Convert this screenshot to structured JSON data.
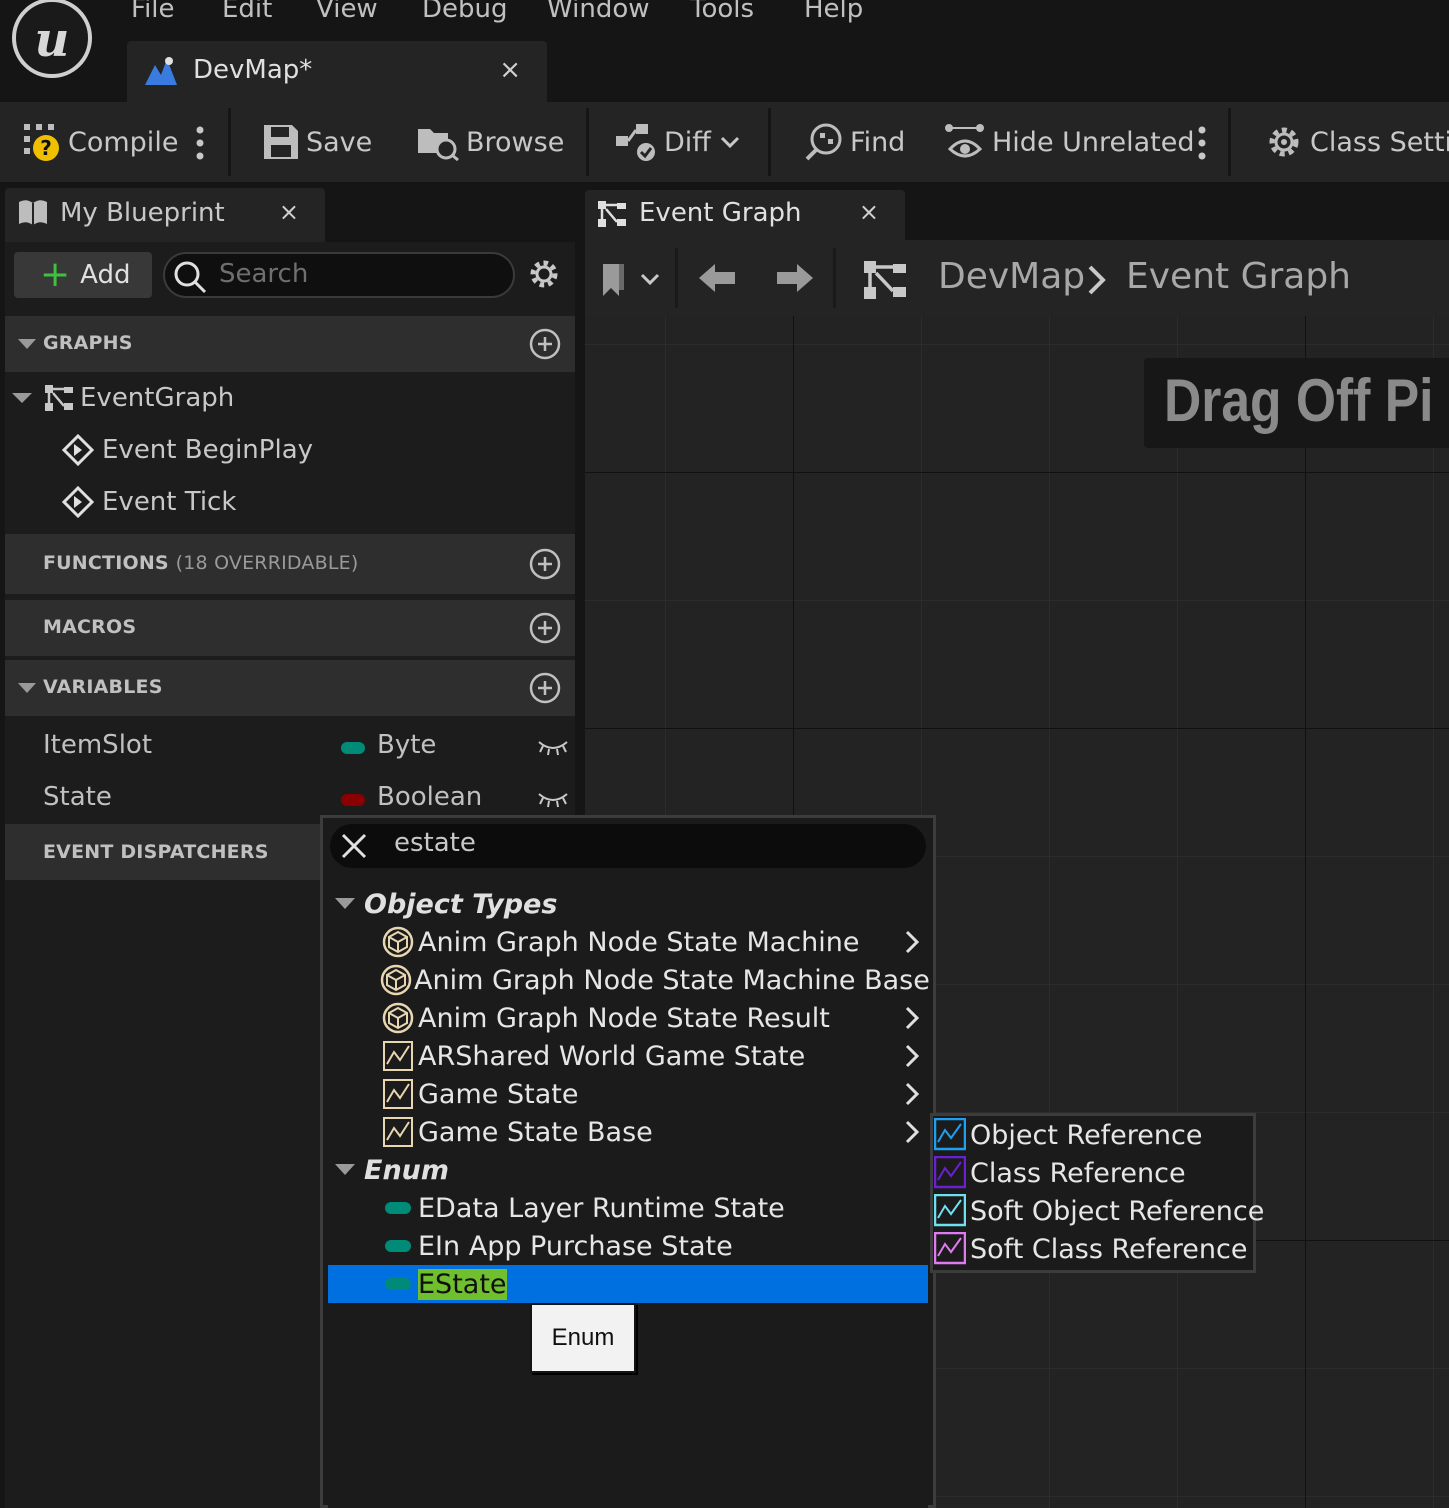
{
  "menu": [
    "File",
    "Edit",
    "View",
    "Debug",
    "Window",
    "Tools",
    "Help"
  ],
  "document_tab": {
    "title": "DevMap*",
    "close": "×"
  },
  "toolbar": {
    "compile": "Compile",
    "save": "Save",
    "browse": "Browse",
    "diff": "Diff",
    "find": "Find",
    "hide_unrelated": "Hide Unrelated",
    "class_settings": "Class Settin"
  },
  "my_blueprint": {
    "tab_title": "My Blueprint",
    "close": "×",
    "add_label": "Add",
    "search_placeholder": "Search",
    "sections": {
      "graphs": "GRAPHS",
      "functions": "FUNCTIONS",
      "functions_sub": "(18 OVERRIDABLE)",
      "macros": "MACROS",
      "variables": "VARIABLES",
      "event_dispatchers": "EVENT DISPATCHERS"
    },
    "graphs": {
      "event_graph": "EventGraph",
      "events": [
        "Event BeginPlay",
        "Event Tick"
      ]
    },
    "variables": [
      {
        "name": "ItemSlot",
        "type": "Byte",
        "color": "#008a78"
      },
      {
        "name": "State",
        "type": "Boolean",
        "color": "#8a0000"
      }
    ]
  },
  "graph_editor": {
    "tab_title": "Event Graph",
    "close": "×",
    "breadcrumb": [
      "DevMap",
      "Event Graph"
    ],
    "overlay_text": "Drag Off Pi"
  },
  "type_picker": {
    "search_value": "estate",
    "categories": {
      "object_types": {
        "label": "Object Types",
        "items": [
          "Anim Graph Node State Machine",
          "Anim Graph Node State Machine Base",
          "Anim Graph Node State Result",
          "ARShared World Game State",
          "Game State",
          "Game State Base"
        ]
      },
      "enum": {
        "label": "Enum",
        "items": [
          "EData Layer Runtime State",
          "EIn App Purchase State",
          "EState"
        ]
      }
    },
    "selected": "EState",
    "tooltip": "Enum"
  },
  "reference_menu": {
    "items": [
      {
        "label": "Object Reference",
        "color": "#1e9ff0"
      },
      {
        "label": "Class Reference",
        "color": "#6a1fd0"
      },
      {
        "label": "Soft Object Reference",
        "color": "#6fe0f0"
      },
      {
        "label": "Soft Class Reference",
        "color": "#e07af0"
      }
    ]
  }
}
